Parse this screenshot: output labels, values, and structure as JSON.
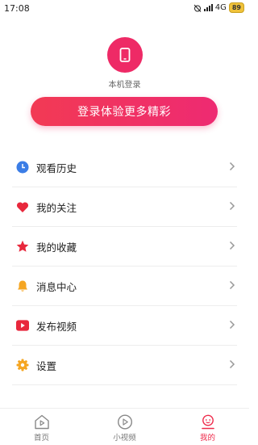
{
  "status": {
    "time": "17:08",
    "network": "4G",
    "battery": "89"
  },
  "login": {
    "label": "本机登录",
    "cta": "登录体验更多精彩"
  },
  "menu": [
    {
      "label": "观看历史",
      "icon": "clock-icon"
    },
    {
      "label": "我的关注",
      "icon": "heart-icon"
    },
    {
      "label": "我的收藏",
      "icon": "star-icon"
    },
    {
      "label": "消息中心",
      "icon": "bell-icon"
    },
    {
      "label": "发布视频",
      "icon": "video-play-icon"
    },
    {
      "label": "设置",
      "icon": "gear-icon"
    }
  ],
  "tabs": [
    {
      "label": "首页",
      "icon": "home-icon"
    },
    {
      "label": "小视频",
      "icon": "play-circle-icon"
    },
    {
      "label": "我的",
      "icon": "profile-icon",
      "active": true
    }
  ],
  "colors": {
    "accent": "#ee2a66",
    "clock": "#3b7de6",
    "heart": "#e8283c",
    "bell": "#f5a623",
    "video": "#e8283c",
    "gear": "#f5a623"
  }
}
